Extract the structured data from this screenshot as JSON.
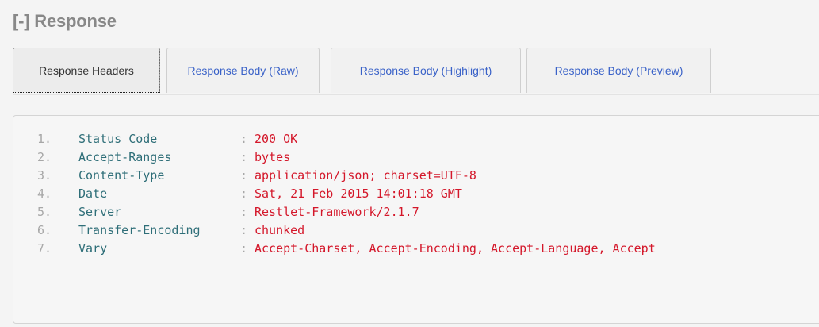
{
  "section": {
    "title": "[-] Response"
  },
  "tabs": [
    {
      "label": "Response Headers",
      "active": true
    },
    {
      "label": "Response Body (Raw)",
      "active": false
    },
    {
      "label": "Response Body (Highlight)",
      "active": false
    },
    {
      "label": "Response Body (Preview)",
      "active": false
    }
  ],
  "colors": {
    "tab_link": "#3a62c8",
    "header_name": "#2e6e78",
    "header_value": "#d4172a",
    "line_number": "#a7a7a7"
  },
  "headers": [
    {
      "num": "1.",
      "name": "Status Code",
      "sep": ":",
      "value": "200 OK"
    },
    {
      "num": "2.",
      "name": "Accept-Ranges",
      "sep": ":",
      "value": "bytes"
    },
    {
      "num": "3.",
      "name": "Content-Type",
      "sep": ":",
      "value": "application/json; charset=UTF-8"
    },
    {
      "num": "4.",
      "name": "Date",
      "sep": ":",
      "value": "Sat, 21 Feb 2015 14:01:18 GMT"
    },
    {
      "num": "5.",
      "name": "Server",
      "sep": ":",
      "value": "Restlet-Framework/2.1.7"
    },
    {
      "num": "6.",
      "name": "Transfer-Encoding",
      "sep": ":",
      "value": "chunked"
    },
    {
      "num": "7.",
      "name": "Vary",
      "sep": ":",
      "value": "Accept-Charset, Accept-Encoding, Accept-Language, Accept"
    }
  ]
}
